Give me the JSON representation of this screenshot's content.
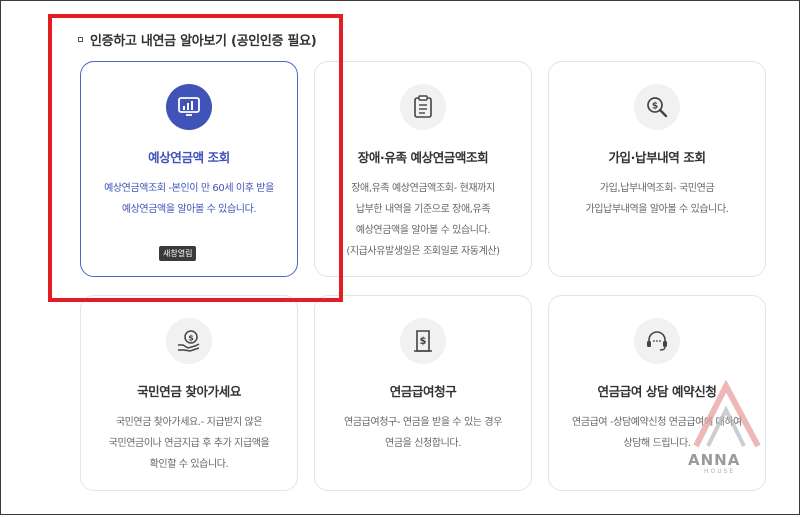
{
  "section": {
    "title": "인증하고 내연금 알아보기 (공인인증 필요)"
  },
  "cards": [
    {
      "title": "예상연금액 조회",
      "description": "예상연금액조회 -본인이 만 60세 이후 받을\n예상연금액을 알아볼 수 있습니다.",
      "badge": "새창열림",
      "icon": "monitor-chart-icon"
    },
    {
      "title": "장애·유족 예상연금액조회",
      "description": "장애,유족 예상연금액조회- 현재까지\n납부한 내역을 기준으로 장애,유족\n예상연금액을 알아볼 수 있습니다.\n(지급사유발생일은 조회일로 자동계산)",
      "icon": "clipboard-list-icon"
    },
    {
      "title": "가입·납부내역 조회",
      "description": "가입,납부내역조회- 국민연금\n가입납부내역을 알아볼 수 있습니다.",
      "icon": "magnifier-dollar-icon"
    },
    {
      "title": "국민연금 찾아가세요",
      "description": "국민연금 찾아가세요.- 지급받지 않은\n국민연금이나 연금지급 후 추가 지급액을\n확인할 수 있습니다.",
      "icon": "hand-coin-icon"
    },
    {
      "title": "연금급여청구",
      "description": "연금급여청구- 연금을 받을 수 있는 경우\n연금을 신청합니다.",
      "icon": "document-dollar-icon"
    },
    {
      "title": "연금급여 상담 예약신청",
      "description": "연금급여 -상담예약신청 연금급여에 대하여\n상담해 드립니다.",
      "icon": "headset-icon"
    }
  ],
  "watermark": {
    "text": "ANNA",
    "sub": "HOUSE"
  },
  "colors": {
    "accent": "#3f53b8",
    "highlight": "#e01e24",
    "badge": "#3a3a3a"
  }
}
